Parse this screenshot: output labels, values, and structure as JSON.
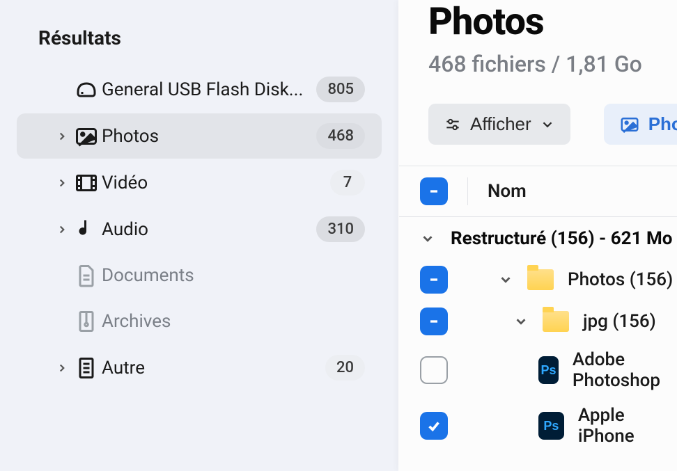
{
  "sidebar": {
    "section_title": "Résultats",
    "items": [
      {
        "label": "General USB Flash Disk...",
        "count": "805",
        "icon": "drive",
        "has_chevron": false,
        "muted": false,
        "light_badge": false
      },
      {
        "label": "Photos",
        "count": "468",
        "icon": "photo",
        "has_chevron": true,
        "selected": true,
        "muted": false,
        "light_badge": false
      },
      {
        "label": "Vidéo",
        "count": "7",
        "icon": "video",
        "has_chevron": true,
        "muted": false,
        "light_badge": true
      },
      {
        "label": "Audio",
        "count": "310",
        "icon": "audio",
        "has_chevron": true,
        "muted": false,
        "light_badge": false
      },
      {
        "label": "Documents",
        "count": "",
        "icon": "doc",
        "has_chevron": false,
        "muted": true
      },
      {
        "label": "Archives",
        "count": "",
        "icon": "archive",
        "has_chevron": false,
        "muted": true
      },
      {
        "label": "Autre",
        "count": "20",
        "icon": "other",
        "has_chevron": true,
        "muted": false,
        "light_badge": true
      }
    ]
  },
  "main": {
    "title": "Photos",
    "subtitle": "468 fichiers / 1,81 Go",
    "display_btn": "Afficher",
    "photos_btn": "Photos",
    "col_name": "Nom",
    "group": "Restructuré (156) - 621 Mo",
    "rows": [
      {
        "label": "Photos (156)",
        "type": "folder",
        "check": "partial",
        "expand": true,
        "indent": 1
      },
      {
        "label": "jpg (156)",
        "type": "folder",
        "check": "partial",
        "expand": true,
        "indent": 2
      },
      {
        "label": "Adobe Photoshop",
        "type": "ps",
        "check": "empty",
        "indent": 3
      },
      {
        "label": "Apple iPhone",
        "type": "ps",
        "check": "checked",
        "indent": 3
      }
    ]
  }
}
